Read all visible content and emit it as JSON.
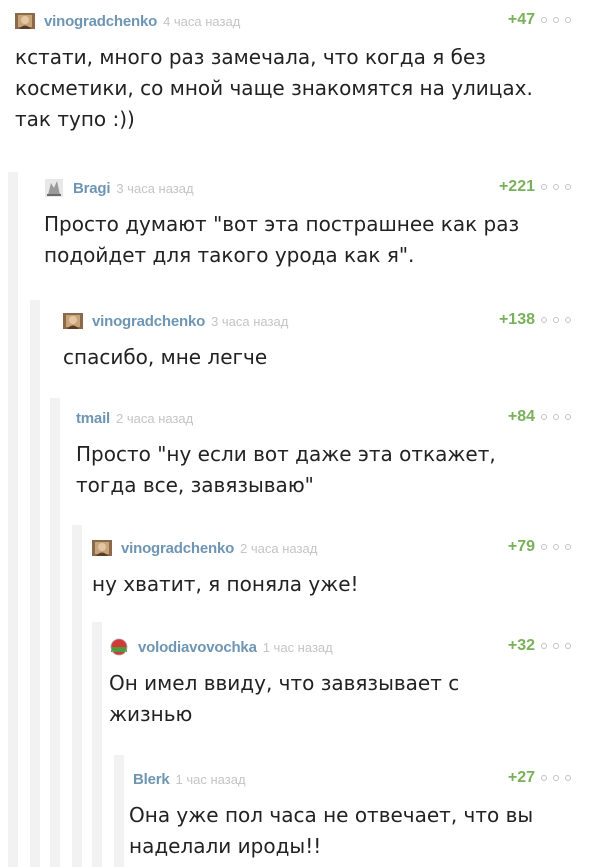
{
  "colors": {
    "username": "#6e96b4",
    "time": "#c4c4c4",
    "rating": "#79b05a",
    "text": "#222222",
    "thread_line": "#f2f2f2"
  },
  "comments": [
    {
      "user": "vinogradchenko",
      "time": "4 часа назад",
      "rating": "+47",
      "text": "кстати, много раз замечала, что когда я без косметики, со мной чаще знакомятся на улицах. так тупо :))",
      "avatar_icon": "portrait-avatar-icon"
    },
    {
      "user": "Bragi",
      "time": "3 часа назад",
      "rating": "+221",
      "text": "Просто думают \"вот эта пострашнее как раз подойдет для такого урода как я\".",
      "avatar_icon": "figure-avatar-icon"
    },
    {
      "user": "vinogradchenko",
      "time": "3 часа назад",
      "rating": "+138",
      "text": "спасибо, мне легче",
      "avatar_icon": "portrait-avatar-icon"
    },
    {
      "user": "tmail",
      "time": "2 часа назад",
      "rating": "+84",
      "text": "Просто \"ну если вот даже эта откажет, тогда все, завязываю\"",
      "avatar_icon": ""
    },
    {
      "user": "vinogradchenko",
      "time": "2 часа назад",
      "rating": "+79",
      "text": "ну хватит, я поняла уже!",
      "avatar_icon": "portrait-avatar-icon"
    },
    {
      "user": "volodiavovochka",
      "time": "1 час назад",
      "rating": "+32",
      "text": "Он имел ввиду, что завязывает с жизнью",
      "avatar_icon": "flag-avatar-icon"
    },
    {
      "user": "Blerk",
      "time": "1 час назад",
      "rating": "+27",
      "text": "Она уже пол часа не отвечает, что вы наделали ироды!!",
      "avatar_icon": ""
    }
  ]
}
